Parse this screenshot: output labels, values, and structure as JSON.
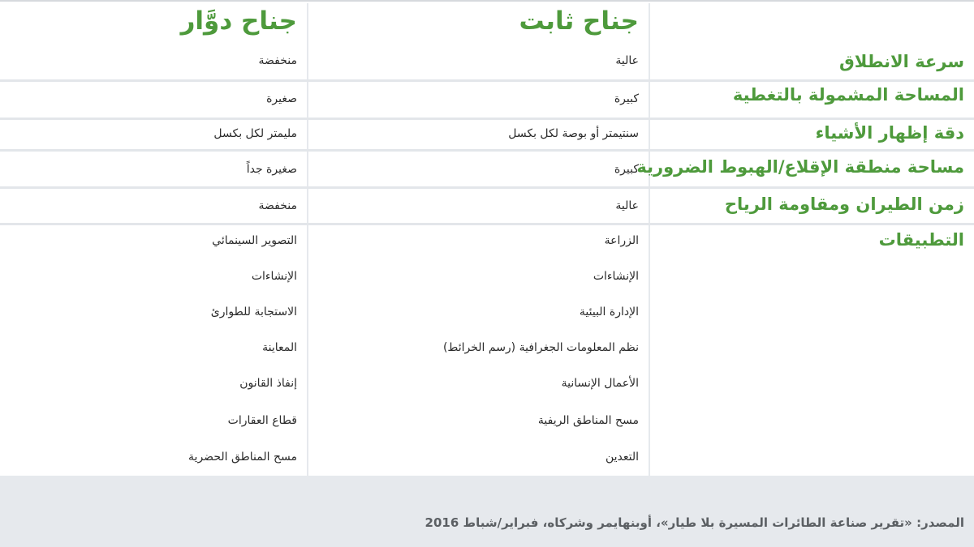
{
  "columns": {
    "fixed_wing": "جناح ثابت",
    "rotary_wing": "جناح دوَّار"
  },
  "rows": [
    {
      "label": "سرعة الانطلاق",
      "fixed": "عالية",
      "rotary": "منخفضة"
    },
    {
      "label": "المساحة المشمولة بالتغطية",
      "fixed": "كبيرة",
      "rotary": "صغيرة"
    },
    {
      "label": "دقة إظهار الأشياء",
      "fixed": "سنتيمتر أو بوصة لكل بكسل",
      "rotary": "مليمتر لكل بكسل"
    },
    {
      "label": "مساحة منطقة الإقلاع/الهبوط الضرورية",
      "fixed": "كبيرة",
      "rotary": "صغيرة جداً"
    },
    {
      "label": "زمن الطيران ومقاومة الرياح",
      "fixed": "عالية",
      "rotary": "منخفضة"
    }
  ],
  "applications": {
    "label": "التطبيقات",
    "fixed": [
      "الزراعة",
      "الإنشاءات",
      "الإدارة البيئية",
      "نظم المعلومات الجغرافية (رسم الخرائط)",
      "الأعمال الإنسانية",
      "مسح المناطق الريفية",
      "التعدين"
    ],
    "rotary": [
      "التصوير السينمائي",
      "الإنشاءات",
      "الاستجابة للطوارئ",
      "المعاينة",
      "إنفاذ القانون",
      "قطاع العقارات",
      "مسح المناطق الحضرية"
    ]
  },
  "source": "المصدر: «تقرير صناعة الطائرات المسيرة بلا طيار»، أوبنهايمر وشركاه، فبراير/شباط 2016"
}
